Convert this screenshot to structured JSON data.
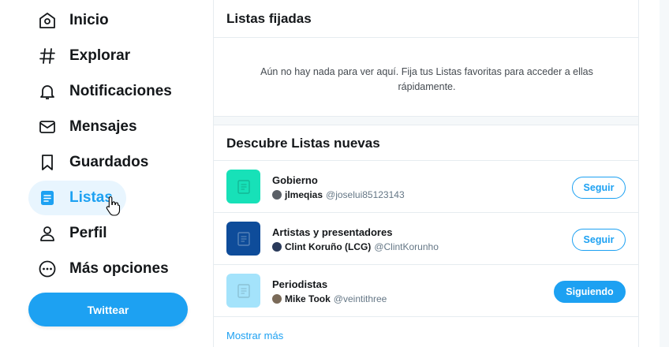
{
  "sidebar": {
    "items": [
      {
        "label": "Inicio",
        "icon": "home-icon"
      },
      {
        "label": "Explorar",
        "icon": "hashtag-icon"
      },
      {
        "label": "Notificaciones",
        "icon": "bell-icon"
      },
      {
        "label": "Mensajes",
        "icon": "envelope-icon"
      },
      {
        "label": "Guardados",
        "icon": "bookmark-icon"
      },
      {
        "label": "Listas",
        "icon": "list-icon",
        "active": true
      },
      {
        "label": "Perfil",
        "icon": "person-icon"
      },
      {
        "label": "Más opciones",
        "icon": "more-circle-icon"
      }
    ],
    "tweet_button": "Twittear"
  },
  "pinned": {
    "title": "Listas fijadas",
    "empty_message": "Aún no hay nada para ver aquí. Fija tus Listas favoritas para acceder a ellas rápidamente."
  },
  "discover": {
    "title": "Descubre Listas nuevas",
    "lists": [
      {
        "name": "Gobierno",
        "owner_name": "jlmeqias",
        "owner_handle": "@joselui85123143",
        "button": "Seguir",
        "following": false,
        "thumb_color": "#17e1b8"
      },
      {
        "name": "Artistas y presentadores",
        "owner_name": "Clint Koruño (LCG)",
        "owner_handle": "@ClintKorunho",
        "button": "Seguir",
        "following": false,
        "thumb_color": "#0e4c9a"
      },
      {
        "name": "Periodistas",
        "owner_name": "Mike Took",
        "owner_handle": "@veintithree",
        "button": "Siguiendo",
        "following": true,
        "thumb_color": "#a4e3fb"
      }
    ],
    "show_more": "Mostrar más"
  },
  "colors": {
    "accent": "#1da1f2",
    "active_bg": "#e8f5fe",
    "border": "#e6ecf0"
  }
}
